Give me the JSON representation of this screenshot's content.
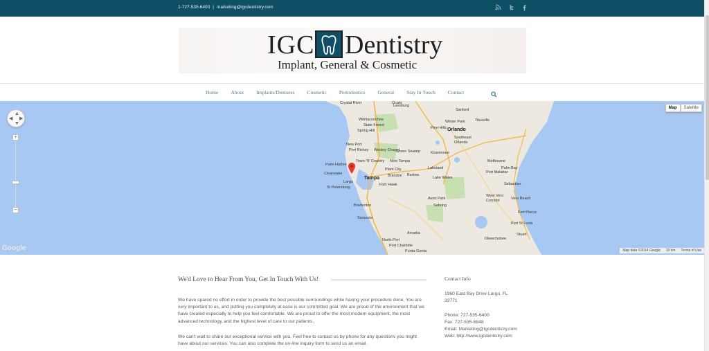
{
  "topbar": {
    "phone": "1-727-535-6400",
    "separator": "|",
    "email": "marketing@igcdentistry.com",
    "social_icons": [
      "rss-icon",
      "twitter-icon",
      "facebook-icon"
    ]
  },
  "logo": {
    "brand_left": "IGC",
    "brand_right": "Dentistry",
    "tagline": "Implant, General & Cosmetic"
  },
  "nav": {
    "items": [
      "Home",
      "About",
      "Implants/Dentures",
      "Cosmetic",
      "Periodontics",
      "General",
      "Stay In Touch",
      "Contact"
    ]
  },
  "map": {
    "type_buttons": [
      "Map",
      "Satellite"
    ],
    "active_type": "Map",
    "google_logo": "Google",
    "attribution": [
      "Map data ©2014 Google",
      "20 km",
      "Terms of Use"
    ],
    "labels": {
      "crystal_river": "Crystal River",
      "ocala": "Ocala",
      "leesburg": "Leesburg",
      "sanford": "Sanford",
      "withlacoochee": "Withlacoochee",
      "state_forest": "State Forest",
      "spring_hill": "Spring Hill",
      "winter_park": "Winter Park",
      "pine_hills": "Pine Hills",
      "titusville": "Titusville",
      "orlando": "Orlando",
      "southeast_orlando": "Southeast",
      "orlando2": "Orlando",
      "kissimmee": "Kissimmee",
      "port_richey": "Port Richey",
      "new_port": "New Port",
      "wesley_chapel": "Wesley Chapel",
      "green_swamp": "Green Swamp",
      "palm_harbor": "Palm Harbor",
      "town_n_country": "Town 'N' Country",
      "new_tampa": "New Tampa",
      "plant_city": "Plant City",
      "lakeland": "Lakeland",
      "clearwater": "Clearwater",
      "tampa": "Tampa",
      "brandon": "Brandon",
      "bartow": "Bartow",
      "largo": "Largo",
      "st_petersburg": "St Petersburg",
      "fish_hawk": "Fish Hawk",
      "lake_wales": "Lake Wales",
      "melbourne": "Melbourne",
      "palm_bay": "Palm Bay",
      "port_malabar": "Port Malabar",
      "sebastian": "Sebastian",
      "bradenton": "Bradenton",
      "avon_park": "Avon Park",
      "west_vero": "West Vero",
      "corridor": "Corridor",
      "vero_beach": "Vero Beach",
      "sebring": "Sebring",
      "sarasota": "Sarasota",
      "fort_pierce": "Fort Pierce",
      "port_st_lucie": "Port St Lucie",
      "stuart": "Stuart",
      "arcadia": "Arcadia",
      "north_port": "North Port",
      "port_charlotte": "Port Charlotte",
      "punta_gorda": "Punta Gorda",
      "okeechobee": "Okeechobee"
    }
  },
  "content": {
    "heading": "We'd Love to Hear From You, Get In Touch With Us!",
    "paragraph1": "We have spared no effort in order to provide the best possible surroundings while having your procedure done. You are very important to us, and putting you completely at ease is our committed goal. We are proud of the environment that we have created especially to help you feel comfortable. We are proud to offer the most modern equipment, the most advanced technology, and the highest level of care to our patients.",
    "paragraph2": "We can't wait to share our exceptional service with you. Feel free to contact us by phone for any questions you might have about our services.  You can also complete the on-line inquiry form to send us an email."
  },
  "sidebar": {
    "title": "Contact Info",
    "address": "1960 East Bay Drive Largo, FL 33771",
    "phone": "Phone: 727-535-6400",
    "fax": "Fax: 727-535-6848",
    "email": "Email: Marketing@Igcdentistry.com",
    "web": "Web: http://www.igcdentistry.com"
  },
  "colors": {
    "topbar": "#0f4f66",
    "nav_link": "#4a7b8c",
    "water": "#a7c8f3",
    "land": "#ede9e1",
    "pin": "#e5392e"
  }
}
